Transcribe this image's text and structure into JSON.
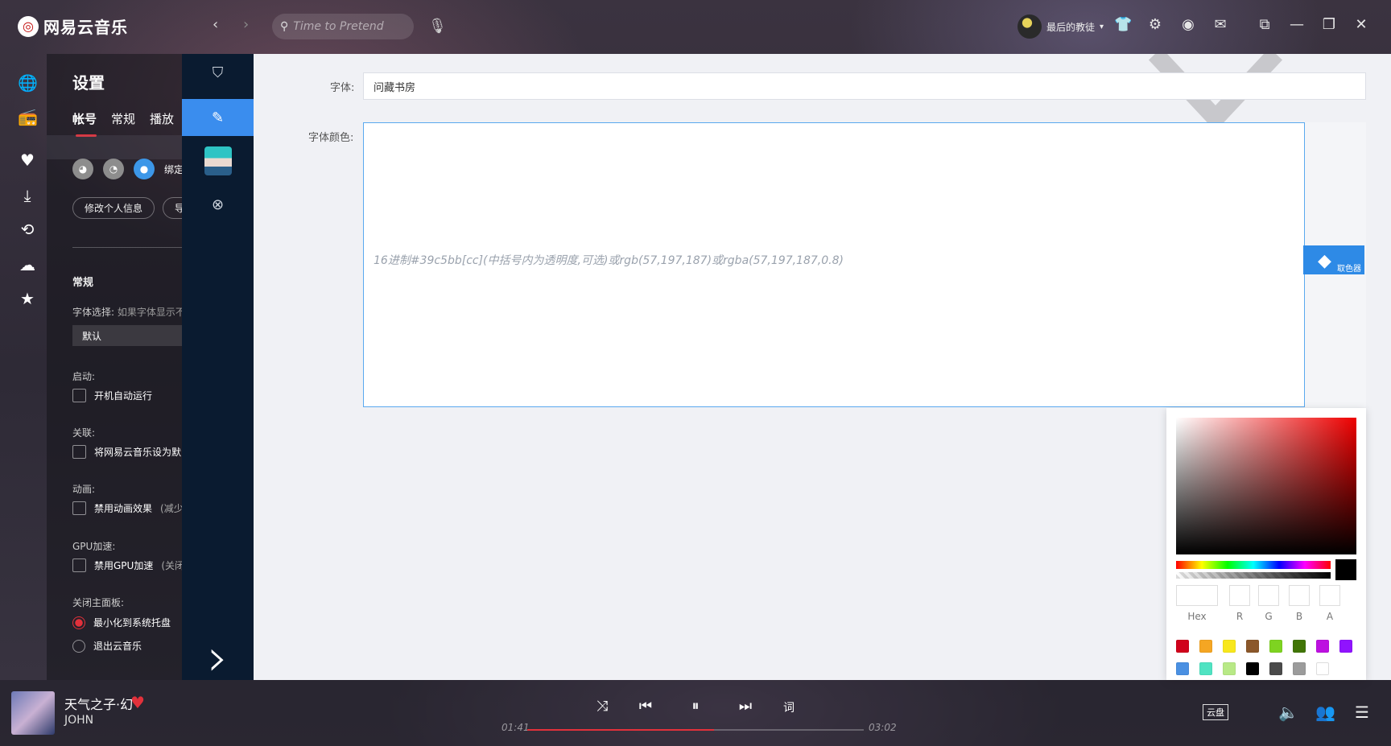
{
  "app": {
    "name": "网易云音乐",
    "logo_icon": "netease-logo-icon"
  },
  "search": {
    "placeholder": "Time to Pretend"
  },
  "user": {
    "name": "最后的教徒"
  },
  "settings": {
    "title": "设置",
    "tabs": [
      "帐号",
      "常规",
      "播放"
    ],
    "bind_label": "绑定",
    "buttons": [
      "修改个人信息",
      "导"
    ],
    "general_heading": "常规",
    "font_select_label": "字体选择:",
    "font_select_hint": "如果字体显示不",
    "font_select_value": "默认",
    "startup_label": "启动:",
    "startup_option": "开机自动运行",
    "assoc_label": "关联:",
    "assoc_option": "将网易云音乐设为默",
    "anim_label": "动画:",
    "anim_option": "禁用动画效果",
    "anim_hint": "(减少",
    "gpu_label": "GPU加速:",
    "gpu_option": "禁用GPU加速",
    "gpu_hint": "(关闭",
    "close_label": "关闭主面板:",
    "close_option1": "最小化到系统托盘",
    "close_option2": "退出云音乐"
  },
  "form": {
    "font_label": "字体:",
    "font_value": "问藏书房",
    "color_label": "字体颜色:",
    "color_placeholder": "16进制#39c5bb[cc](中括号内为透明度,可选)或rgb(57,197,187)或rgba(57,197,187,0.8)",
    "picker_button_label": "取色器"
  },
  "color_picker": {
    "channel_labels": [
      "Hex",
      "R",
      "G",
      "B",
      "A"
    ],
    "current_color": "#000000",
    "swatches": [
      "#d0021b",
      "#f5a623",
      "#f8e71c",
      "#8b572a",
      "#7ed321",
      "#417505",
      "#bd10e0",
      "#9013fe",
      "#4a90e2",
      "#50e3c2",
      "#b8e986",
      "#000000",
      "#4a4a4a",
      "#9b9b9b",
      "#ffffff"
    ]
  },
  "player": {
    "title": "天气之子·幻",
    "artist": "JOHN",
    "current_time": "01:41",
    "total_time": "03:02",
    "progress": 0.554,
    "lyrics_label": "词",
    "cloud_label": "云盘"
  },
  "colors": {
    "accent_red": "#e2313b",
    "accent_blue": "#3a8dee",
    "plugin_nav_bg": "#0a1b30"
  }
}
